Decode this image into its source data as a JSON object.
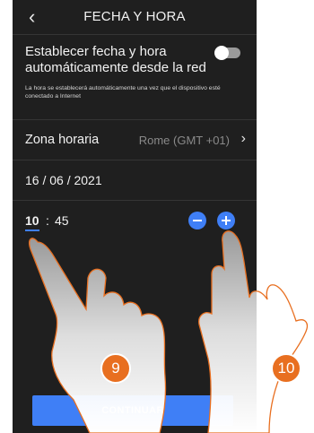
{
  "header": {
    "title": "FECHA Y HORA",
    "back_icon": "chevron-left-icon"
  },
  "auto_time": {
    "label": "Establecer fecha y hora automáticamente desde la red",
    "note": "La hora se establecerá automáticamente una vez que el dispositivo esté conectado a Internet",
    "enabled": false
  },
  "timezone": {
    "label": "Zona horaria",
    "value": "Rome (GMT +01)",
    "chevron_icon": "chevron-right-icon"
  },
  "date": {
    "value": "16 / 06 / 2021"
  },
  "time": {
    "hour": "10",
    "separator": ":",
    "minute": "45"
  },
  "buttons": {
    "continue_label": "CONTINUAR"
  },
  "callouts": {
    "first": "9",
    "second": "10"
  },
  "colors": {
    "background": "#1f1f1f",
    "accent": "#3f7ff6",
    "callout": "#e86f20"
  }
}
